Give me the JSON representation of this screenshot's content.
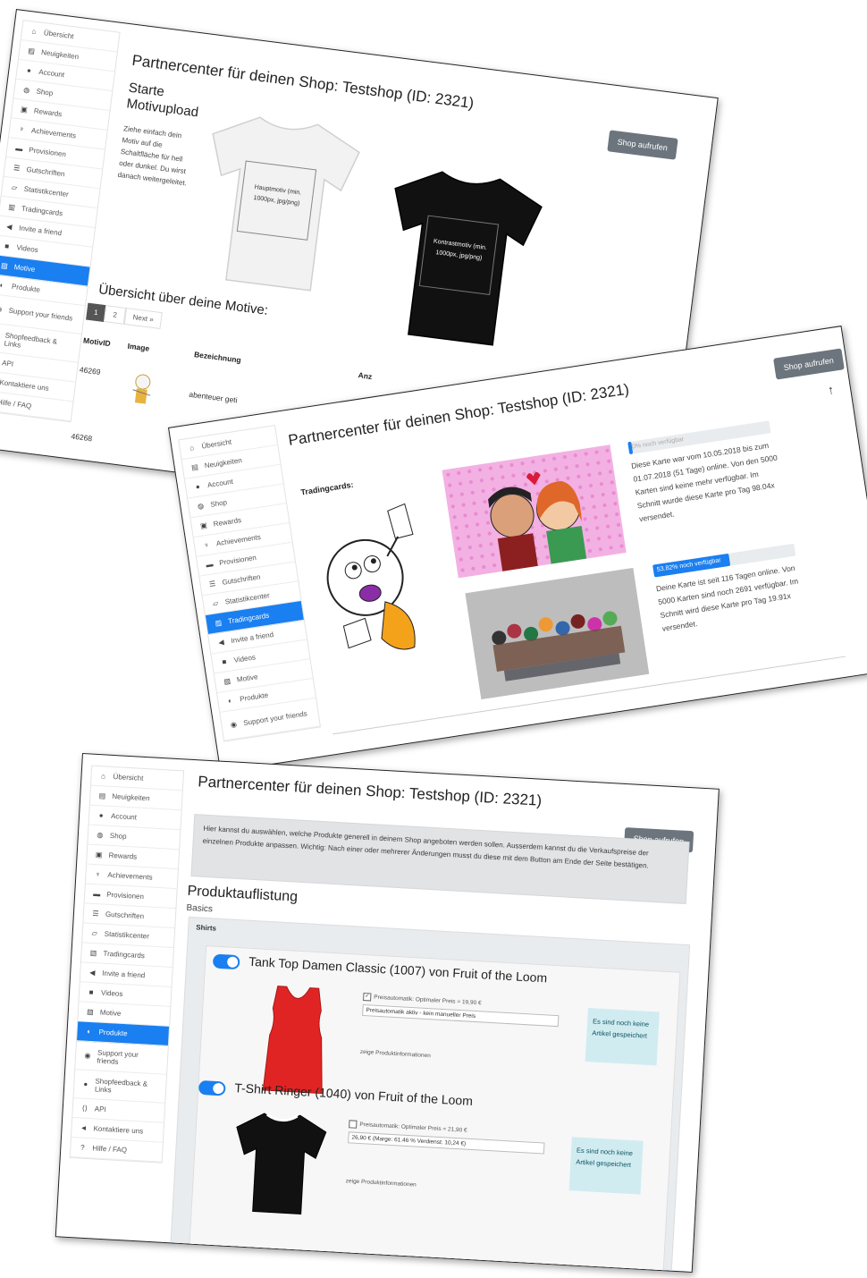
{
  "sidebar": {
    "items": [
      {
        "label": "Übersicht",
        "icon": "home-icon"
      },
      {
        "label": "Neuigkeiten",
        "icon": "newspaper-icon"
      },
      {
        "label": "Account",
        "icon": "user-icon"
      },
      {
        "label": "Shop",
        "icon": "globe-icon"
      },
      {
        "label": "Rewards",
        "icon": "gift-icon"
      },
      {
        "label": "Achievements",
        "icon": "trophy-icon"
      },
      {
        "label": "Provisionen",
        "icon": "money-icon"
      },
      {
        "label": "Gutschriften",
        "icon": "list-icon"
      },
      {
        "label": "Statistikcenter",
        "icon": "chart-icon"
      },
      {
        "label": "Tradingcards",
        "icon": "cards-icon"
      },
      {
        "label": "Invite a friend",
        "icon": "bullhorn-icon"
      },
      {
        "label": "Videos",
        "icon": "video-icon"
      },
      {
        "label": "Motive",
        "icon": "image-icon"
      },
      {
        "label": "Produkte",
        "icon": "toggle-icon"
      },
      {
        "label": "Support your friends",
        "icon": "support-icon"
      },
      {
        "label": "Shopfeedback & Links",
        "icon": "comment-icon"
      },
      {
        "label": "API",
        "icon": "code-icon"
      },
      {
        "label": "Kontaktiere uns",
        "icon": "megaphone-icon"
      },
      {
        "label": "Hilfe / FAQ",
        "icon": "question-icon"
      }
    ]
  },
  "header": {
    "title": "Partnercenter für deinen Shop: Testshop (ID: 2321)",
    "shop_button": "Shop aufrufen"
  },
  "motive": {
    "upload_heading": "Starte Motivupload",
    "upload_text": "Ziehe einfach dein Motiv auf die Schaltfläche für hell oder dunkel. Du wirst danach weitergeleitet.",
    "main_motif": "Hauptmotiv (min. 1000px, jpg/png)",
    "contrast_motif": "Kontrastmotiv (min. 1000px, jpg/png)",
    "overview_heading": "Übersicht über deine Motive:",
    "pagination": [
      "1",
      "2",
      "Next »"
    ],
    "table_headers": [
      "MotivID",
      "Image",
      "Bezeichnung",
      "Anz"
    ],
    "rows": [
      {
        "id": "46269",
        "name": "abenteuer geti"
      },
      {
        "id": "46268",
        "name": ""
      }
    ]
  },
  "tradingcards": {
    "heading": "Tradingcards:",
    "card1_progress": "0% noch verfügbar",
    "card1_progress_value": 0,
    "card1_text": "Diese Karte war vom 10.05.2018 bis zum 01.07.2018 (51 Tage) online. Von den 5000 Karten sind keine mehr verfügbar. Im Schnitt wurde diese Karte pro Tag 98.04x versendet.",
    "card2_progress": "53.82% noch verfügbar",
    "card2_progress_value": 53.82,
    "card2_text": "Deine Karte ist seit 116 Tagen online. Von 5000 Karten sind noch 2691 verfügbar. Im Schnitt wird diese Karte pro Tag 19.91x versendet."
  },
  "produkte": {
    "intro": "Hier kannst du auswählen, welche Produkte generell in deinem Shop angeboten werden sollen. Ausserdem kannst du die Verkaufspreise der einzelnen Produkte anpassen. Wichtig: Nach einer oder mehrerer Änderungen musst du diese mit dem Button am Ende der Seite bestätigen.",
    "heading": "Produktauflistung",
    "subheading": "Basics",
    "category": "Shirts",
    "products": [
      {
        "name": "Tank Top Damen Classic (1007) von Fruit of the Loom",
        "price_auto_label": "Preisautomatik: Optimaler Preis = 19,90 €",
        "price_auto_checked": true,
        "select_value": "Preisautomatik aktiv - kein manueller Preis",
        "info": "Es sind noch keine Artikel gespeichert",
        "link": "zeige Produktinformationen",
        "color": "#e02424"
      },
      {
        "name": "T-Shirt Ringer (1040) von Fruit of the Loom",
        "price_auto_label": "Preisautomatik: Optimaler Preis = 21,90 €",
        "price_auto_checked": false,
        "select_value": "26,90 € (Marge: 61.46 % Verdienst: 10,24 €)",
        "info": "Es sind noch keine Artikel gespeichert",
        "link": "zeige Produktinformationen",
        "color": "#111111"
      }
    ]
  },
  "colors": {
    "accent": "#1a7ff0",
    "button_gray": "#6c757d",
    "info_bg": "#d1ecf1"
  }
}
